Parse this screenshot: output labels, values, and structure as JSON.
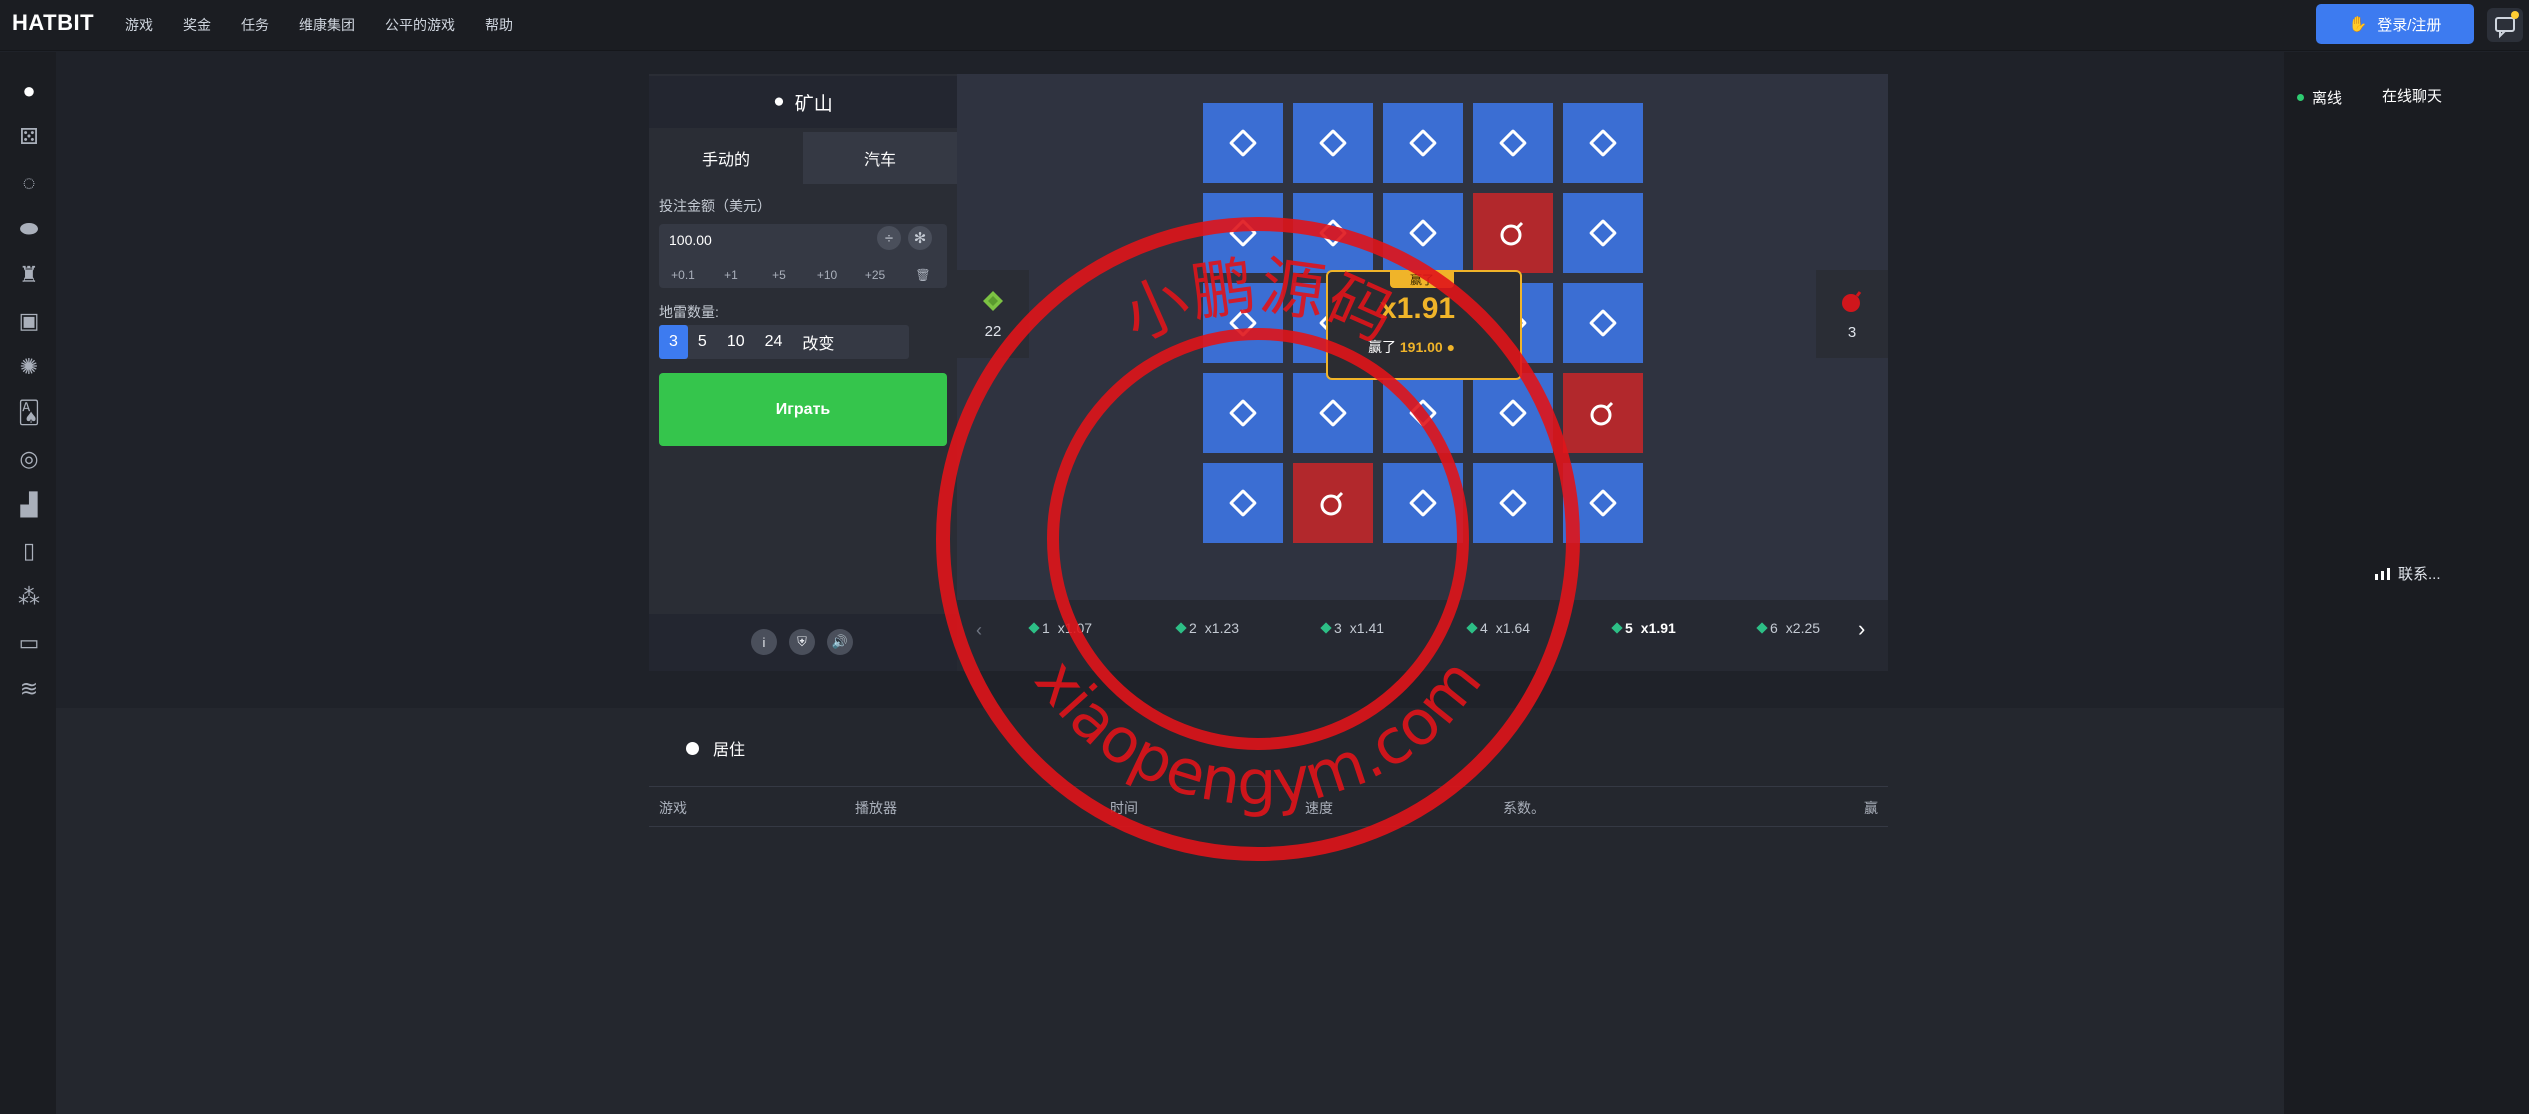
{
  "brand": {
    "logo": "HATBIT"
  },
  "nav": {
    "items": [
      "游戏",
      "奖金",
      "任务",
      "维康集团",
      "公平的游戏",
      "帮助"
    ]
  },
  "header": {
    "login_label": "登录/注册"
  },
  "sidebar": {
    "icons": [
      "bomb-icon",
      "dice-icon",
      "crash-icon",
      "coin-icon",
      "tower-icon",
      "keno-icon",
      "wheel-icon",
      "cards-icon",
      "roulette-icon",
      "chart-icon",
      "hilo-icon",
      "plinko-icon",
      "case-icon",
      "stack-icon"
    ]
  },
  "game": {
    "title": "矿山",
    "tabs": [
      "手动的",
      "汽车"
    ],
    "bet_label": "投注金额（美元）",
    "bet_value": "100.00",
    "half_symbol": "÷",
    "double_symbol": "✻",
    "quick_amounts": [
      "+0.1",
      "+1",
      "+5",
      "+10",
      "+25"
    ],
    "mines_label": "地雷数量:",
    "mine_options": [
      "3",
      "5",
      "10",
      "24",
      "改变"
    ],
    "selected_mines": "3",
    "play_label": "Играть",
    "gems_left": "22",
    "mines_left": "3",
    "win_tag": "赢了",
    "win_multiplier": "x1.91",
    "win_text": "赢了",
    "win_amount": "191.00",
    "multipliers": [
      {
        "step": "1",
        "value": "x1.07"
      },
      {
        "step": "2",
        "value": "x1.23"
      },
      {
        "step": "3",
        "value": "x1.41"
      },
      {
        "step": "4",
        "value": "x1.64"
      },
      {
        "step": "5",
        "value": "x1.91"
      },
      {
        "step": "6",
        "value": "x2.25"
      }
    ]
  },
  "history": {
    "title": "居住",
    "columns": [
      "游戏",
      "播放器",
      "时间",
      "速度",
      "系数。",
      "赢"
    ]
  },
  "chat": {
    "status": "离线",
    "title": "在线聊天",
    "connecting": "联系..."
  },
  "watermark": {
    "top_text": "小鹏源码",
    "bottom_text": "xiaopengym.com"
  },
  "colors": {
    "accent": "#3d7bf0",
    "play": "#35c54c",
    "mine": "#b2282c",
    "tile": "#3b6ed3",
    "win": "#f0b429",
    "stamp": "#e0141a"
  }
}
